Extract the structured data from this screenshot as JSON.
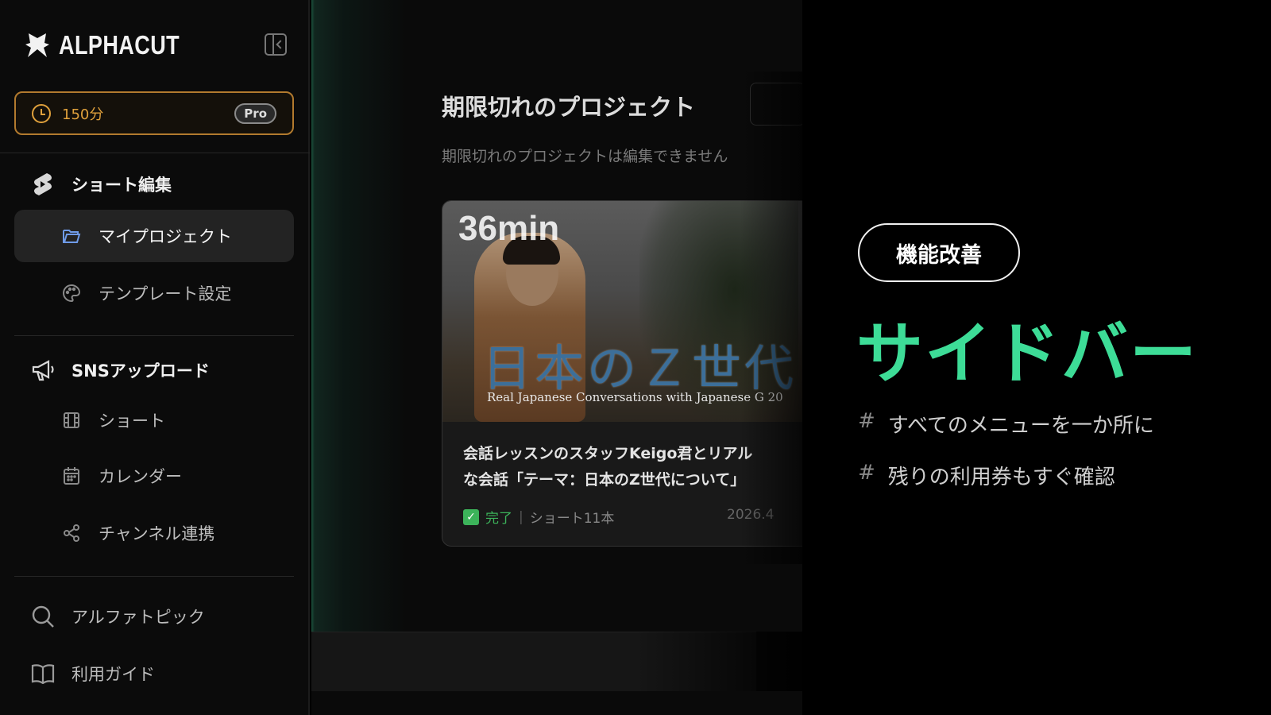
{
  "brand": {
    "name": "ALPHACUT"
  },
  "credits": {
    "minutes": "150分",
    "plan": "Pro"
  },
  "sidebar": {
    "short_edit": {
      "heading": "ショート編集",
      "items": [
        {
          "label": "マイプロジェクト",
          "icon": "folder-icon",
          "active": true
        },
        {
          "label": "テンプレート設定",
          "icon": "palette-icon",
          "active": false
        }
      ]
    },
    "sns_upload": {
      "heading": "SNSアップロード",
      "items": [
        {
          "label": "ショート",
          "icon": "film-icon"
        },
        {
          "label": "カレンダー",
          "icon": "calendar-icon"
        },
        {
          "label": "チャンネル連携",
          "icon": "share-icon"
        }
      ]
    },
    "bottom": [
      {
        "label": "アルファトピック",
        "icon": "search-icon"
      },
      {
        "label": "利用ガイド",
        "icon": "book-icon"
      }
    ]
  },
  "main": {
    "title": "期限切れのプロジェクト",
    "subtitle": "期限切れのプロジェクトは編集できません",
    "card": {
      "thumbnail": {
        "duration": "36min",
        "jp_title": "日本のＺ世代",
        "en_subtitle": "Real Japanese Conversations with Japanese G 20"
      },
      "title_line1": "会話レッスンのスタッフKeigo君とリアル",
      "title_line2": "な会話「テーマ：日本のZ世代について」",
      "status": "完了",
      "separator": "|",
      "shorts_count": "ショート11本",
      "date": "2026.4"
    }
  },
  "promo": {
    "badge": "機能改善",
    "headline": "サイドバー",
    "points": [
      "すべてのメニューを一か所に",
      "残りの利用券もすぐ確認"
    ],
    "hash": "#"
  },
  "colors": {
    "accent_green": "#3ddc97",
    "credit_orange": "#e0a13c",
    "active_blue": "#6f9be8"
  }
}
